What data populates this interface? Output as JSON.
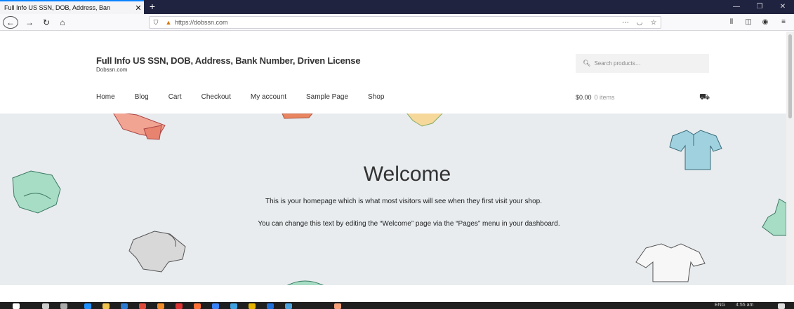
{
  "browser": {
    "tab_title": "Full Info US SSN, DOB, Address, Ban",
    "tab_close": "✕",
    "new_tab": "+",
    "url": "https://dobssn.com"
  },
  "site": {
    "title": "Full Info US SSN, DOB, Address, Bank Number, Driven License",
    "tagline": "Dobssn.com",
    "search_placeholder": "Search products…"
  },
  "menu": [
    "Home",
    "Blog",
    "Cart",
    "Checkout",
    "My account",
    "Sample Page",
    "Shop"
  ],
  "cart": {
    "amount": "$0.00",
    "items": "0 items"
  },
  "hero": {
    "heading": "Welcome",
    "line1": "This is your homepage which is what most visitors will see when they first visit your shop.",
    "line2": "You can change this text by editing the “Welcome” page via the “Pages” menu in your dashboard."
  },
  "taskbar": {
    "lang": "ENG",
    "time": "4:55 am"
  },
  "colors": {
    "tabbar": "#202340",
    "accent": "#0a84ff",
    "hero_bg": "#e8ecef"
  }
}
